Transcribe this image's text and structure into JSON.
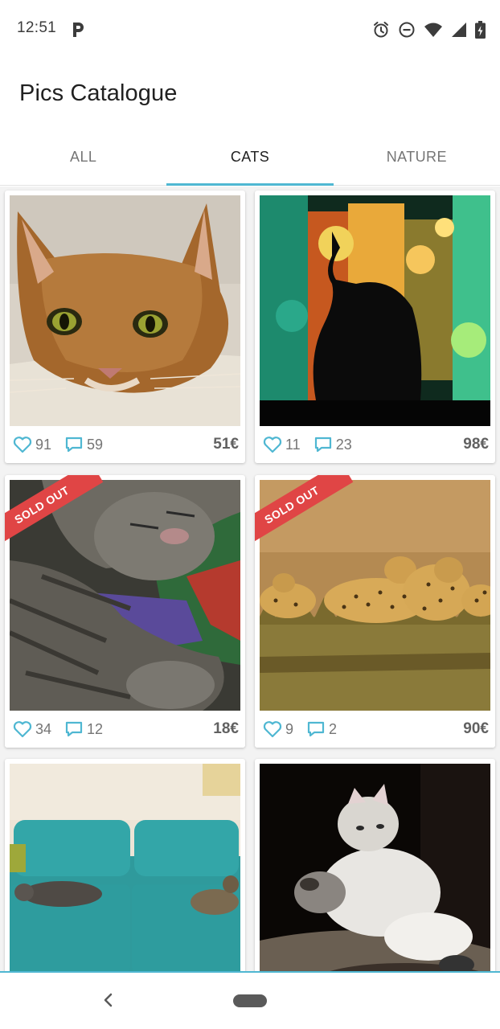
{
  "status_bar": {
    "time": "12:51",
    "icons": [
      "parking-icon",
      "alarm-icon",
      "do-not-disturb-icon",
      "wifi-icon",
      "signal-icon",
      "battery-icon"
    ]
  },
  "app": {
    "title": "Pics Catalogue"
  },
  "tabs": [
    {
      "label": "ALL",
      "active": false
    },
    {
      "label": "CATS",
      "active": true
    },
    {
      "label": "NATURE",
      "active": false
    }
  ],
  "cards": [
    {
      "likes": "91",
      "comments": "59",
      "price": "51€",
      "sold_out": false
    },
    {
      "likes": "11",
      "comments": "23",
      "price": "98€",
      "sold_out": false
    },
    {
      "likes": "34",
      "comments": "12",
      "price": "18€",
      "sold_out": true,
      "badge": "SOLD OUT"
    },
    {
      "likes": "9",
      "comments": "2",
      "price": "90€",
      "sold_out": true,
      "badge": "SOLD OUT"
    },
    {
      "likes": "",
      "comments": "",
      "price": "",
      "sold_out": false
    },
    {
      "likes": "",
      "comments": "",
      "price": "",
      "sold_out": false
    }
  ],
  "colors": {
    "accent": "#4fb7d2",
    "sold_out": "#e04545",
    "price": "#616161"
  }
}
